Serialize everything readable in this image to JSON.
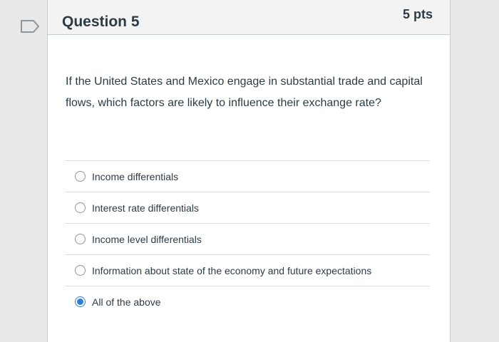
{
  "question": {
    "title": "Question 5",
    "points": "5 pts",
    "text": "If the United States and Mexico engage in substantial trade and capital flows, which factors are likely to influence their exchange rate?"
  },
  "answers": [
    {
      "label": "Income differentials",
      "selected": false
    },
    {
      "label": "Interest rate differentials",
      "selected": false
    },
    {
      "label": "Income level differentials",
      "selected": false
    },
    {
      "label": "Information about state of the economy and future expectations",
      "selected": false
    },
    {
      "label": "All of the above",
      "selected": true
    }
  ],
  "colors": {
    "selected_radio": "#2d7fd3",
    "text": "#2d3b45",
    "header_bg": "#f3f3f4"
  },
  "icons": {
    "flag": "flag-question-icon"
  }
}
